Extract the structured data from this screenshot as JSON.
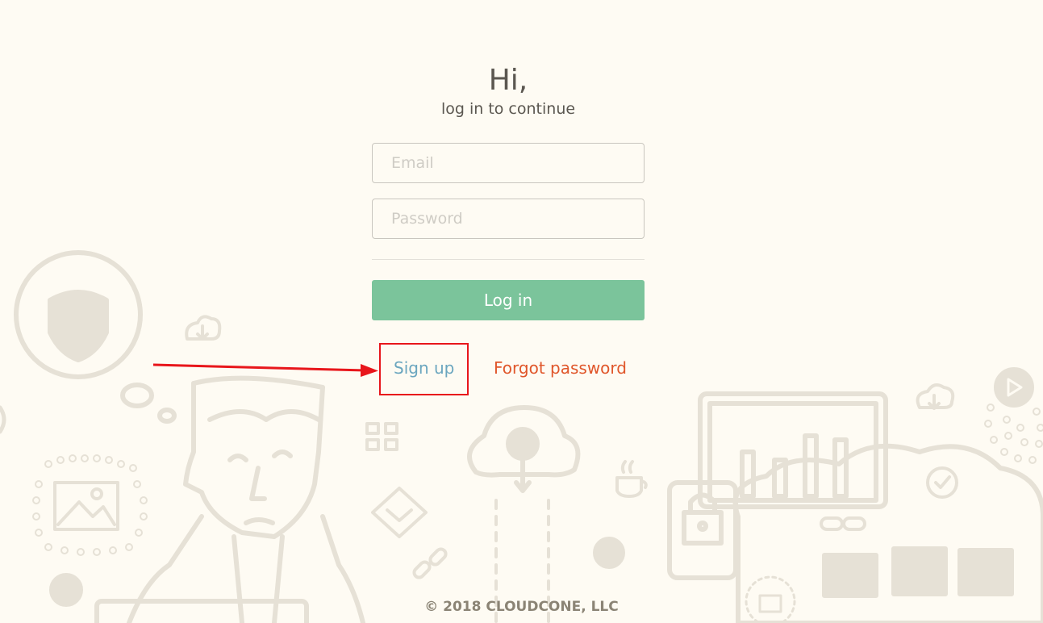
{
  "header": {
    "title": "Hi,",
    "subtitle": "log in to continue"
  },
  "form": {
    "email_placeholder": "Email",
    "password_placeholder": "Password",
    "login_label": "Log in"
  },
  "links": {
    "signup_label": "Sign up",
    "forgot_label": "Forgot password"
  },
  "footer": {
    "copyright": "© 2018 CLOUDCONE, LLC"
  },
  "colors": {
    "background": "#fefbf3",
    "login_button": "#7bc49b",
    "signup_link": "#6ba6bf",
    "forgot_link": "#e0562a",
    "annotation": "#e8161b",
    "illustration": "#e6e1d6"
  }
}
